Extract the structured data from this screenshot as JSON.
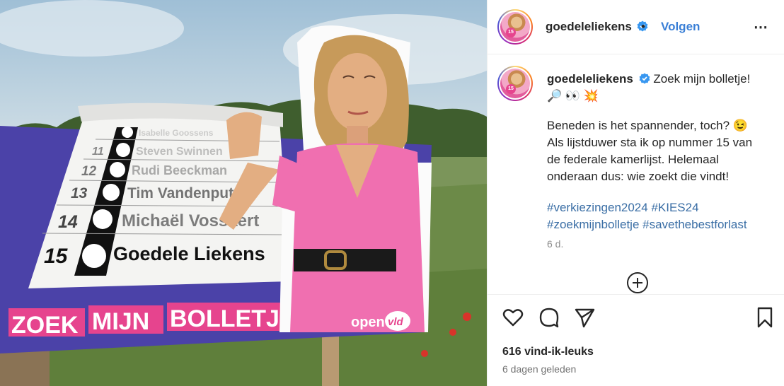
{
  "post": {
    "image": {
      "billboard_rows": [
        {
          "number": "",
          "name": "Isabelle Goossens"
        },
        {
          "number": "11",
          "name": "Steven Swinnen"
        },
        {
          "number": "12",
          "name": "Rudi Beeckman"
        },
        {
          "number": "13",
          "name": "Tim Vandenput"
        },
        {
          "number": "14",
          "name": "Michaël Vossaert"
        },
        {
          "number": "15",
          "name": "Goedele Liekens"
        }
      ],
      "slogan_words": [
        "ZOEK",
        "MIJN",
        "BOLLETJE"
      ],
      "party_logo": {
        "word1": "open",
        "word2": "vld"
      },
      "colors": {
        "pink": "#e6448e",
        "purple": "#4b42a8",
        "dress": "#f06fb0"
      }
    },
    "header": {
      "username": "goedeleliekens",
      "separator": "•",
      "follow_label": "Volgen",
      "more_icon": "⋯"
    },
    "caption": {
      "username": "goedeleliekens",
      "title": "Zoek mijn bolletje!",
      "emojis": "🔎 👀 💥",
      "body_lines": [
        "Beneden is het spannender, toch? 😉",
        "Als lijstduwer sta ik op nummer 15 van",
        "de federale kamerlijst. Helemaal",
        "onderaan dus: wie zoekt die vindt!"
      ],
      "hashtags_line1": "#verkiezingen2024 #KIES24",
      "hashtags_line2": "#zoekmijnbolletje #savethebestforlast",
      "time": "6 d."
    },
    "footer": {
      "likes": "616 vind-ik-leuks",
      "ago": "6 dagen geleden"
    }
  }
}
